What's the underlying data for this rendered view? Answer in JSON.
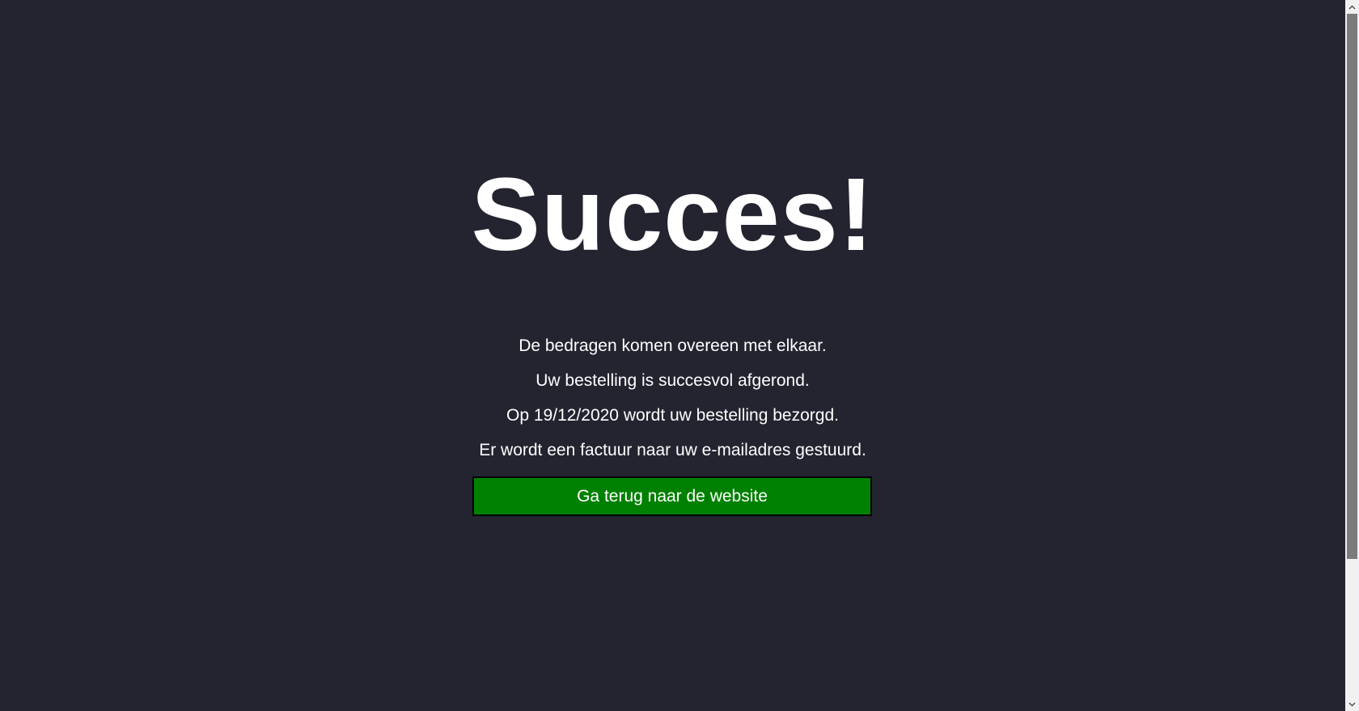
{
  "page": {
    "title": "Succes!",
    "messages": [
      "De bedragen komen overeen met elkaar.",
      "Uw bestelling is succesvol afgerond.",
      "Op 19/12/2020 wordt uw bestelling bezorgd.",
      "Er wordt een factuur naar uw e-mailadres gestuurd."
    ],
    "back_button_label": "Ga terug naar de website"
  },
  "colors": {
    "background": "#232430",
    "text": "#ffffff",
    "button": "#008000",
    "button_border": "#000000"
  },
  "scrollbar": {
    "up_icon": "chevron-up-icon",
    "down_icon": "chevron-down-icon"
  }
}
